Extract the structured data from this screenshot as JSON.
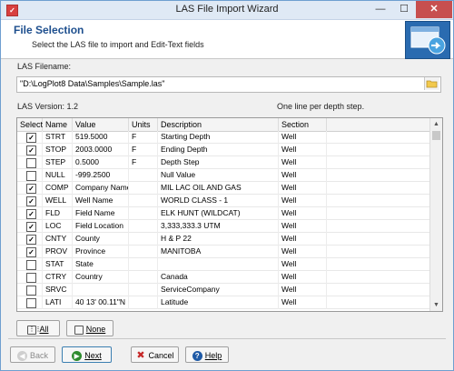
{
  "window": {
    "title": "LAS File Import Wizard"
  },
  "header": {
    "title": "File Selection",
    "subtitle": "Select the LAS file to import and Edit-Text fields"
  },
  "las_filename": {
    "label": "LAS Filename:",
    "value": "\"D:\\LogPlot8 Data\\Samples\\Sample.las\""
  },
  "info": {
    "version": "LAS Version: 1.2",
    "wrap": "One line per depth step."
  },
  "table": {
    "columns": [
      "Select",
      "Name",
      "Value",
      "Units",
      "Description",
      "Section"
    ],
    "rows": [
      {
        "checked": true,
        "name": "STRT",
        "value": "519.5000",
        "units": "F",
        "description": "Starting Depth",
        "section": "Well"
      },
      {
        "checked": true,
        "name": "STOP",
        "value": "2003.0000",
        "units": "F",
        "description": "Ending Depth",
        "section": "Well"
      },
      {
        "checked": false,
        "name": "STEP",
        "value": "0.5000",
        "units": "F",
        "description": "Depth Step",
        "section": "Well"
      },
      {
        "checked": false,
        "name": "NULL",
        "value": "-999.2500",
        "units": "",
        "description": "Null Value",
        "section": "Well"
      },
      {
        "checked": true,
        "name": "COMP",
        "value": "Company Name",
        "units": "",
        "description": "MIL LAC OIL AND GAS",
        "section": "Well"
      },
      {
        "checked": true,
        "name": "WELL",
        "value": "Well Name",
        "units": "",
        "description": "WORLD CLASS - 1",
        "section": "Well"
      },
      {
        "checked": true,
        "name": "FLD",
        "value": "Field Name",
        "units": "",
        "description": "ELK HUNT (WILDCAT)",
        "section": "Well"
      },
      {
        "checked": true,
        "name": "LOC",
        "value": "Field Location",
        "units": "",
        "description": "3,333,333.3 UTM",
        "section": "Well"
      },
      {
        "checked": true,
        "name": "CNTY",
        "value": "County",
        "units": "",
        "description": "H & P 22",
        "section": "Well"
      },
      {
        "checked": true,
        "name": "PROV",
        "value": "Province",
        "units": "",
        "description": "MANITOBA",
        "section": "Well"
      },
      {
        "checked": false,
        "name": "STAT",
        "value": "State",
        "units": "",
        "description": "",
        "section": "Well"
      },
      {
        "checked": false,
        "name": "CTRY",
        "value": "Country",
        "units": "",
        "description": "Canada",
        "section": "Well"
      },
      {
        "checked": false,
        "name": "SRVC",
        "value": "",
        "units": "",
        "description": "ServiceCompany",
        "section": "Well"
      },
      {
        "checked": false,
        "name": "LATI",
        "value": "40 13' 00.11\"N",
        "units": "",
        "description": "Latitude",
        "section": "Well"
      }
    ]
  },
  "buttons": {
    "all": "All",
    "none": "None",
    "back": "Back",
    "next": "Next",
    "cancel": "Cancel",
    "help": "Help"
  },
  "colors": {
    "accent": "#1e4f8e",
    "close": "#c74f4f",
    "cancel_icon": "#c62828",
    "next_icon": "#2e8b2e",
    "help_icon": "#1f5aa6"
  }
}
